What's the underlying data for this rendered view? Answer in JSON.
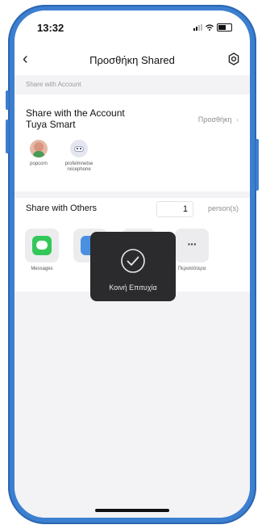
{
  "status_bar": {
    "time": "13:32"
  },
  "nav": {
    "back_glyph": "‹",
    "title": "Προσθήκη Shared",
    "settings_icon": "gear-icon"
  },
  "account_section": {
    "header": "Share with Account",
    "title_line1": "Share with the Account",
    "title_line2": "Tuya Smart",
    "action": "Προσθήκη",
    "action_chevron": "›"
  },
  "members": [
    {
      "name": "popcorn"
    },
    {
      "name_line1": "profelmnetse",
      "name_line2": "rvicephone"
    }
  ],
  "others_section": {
    "label": "Share with Others",
    "count": "1",
    "unit": "person(s)"
  },
  "apps": [
    {
      "label": "Messages",
      "icon": "message-icon"
    },
    {
      "label": "",
      "icon": "app-icon"
    },
    {
      "label": "",
      "icon": "app-icon"
    },
    {
      "label": "Περισσότερα",
      "icon": "more-icon",
      "glyph": "···"
    }
  ],
  "toast": {
    "text": "Κοινή Επιτυχία",
    "icon": "check-circle-icon"
  },
  "colors": {
    "frame": "#3c7fd0",
    "messages_green": "#34c759",
    "toast_bg": "#2b2b2d"
  }
}
